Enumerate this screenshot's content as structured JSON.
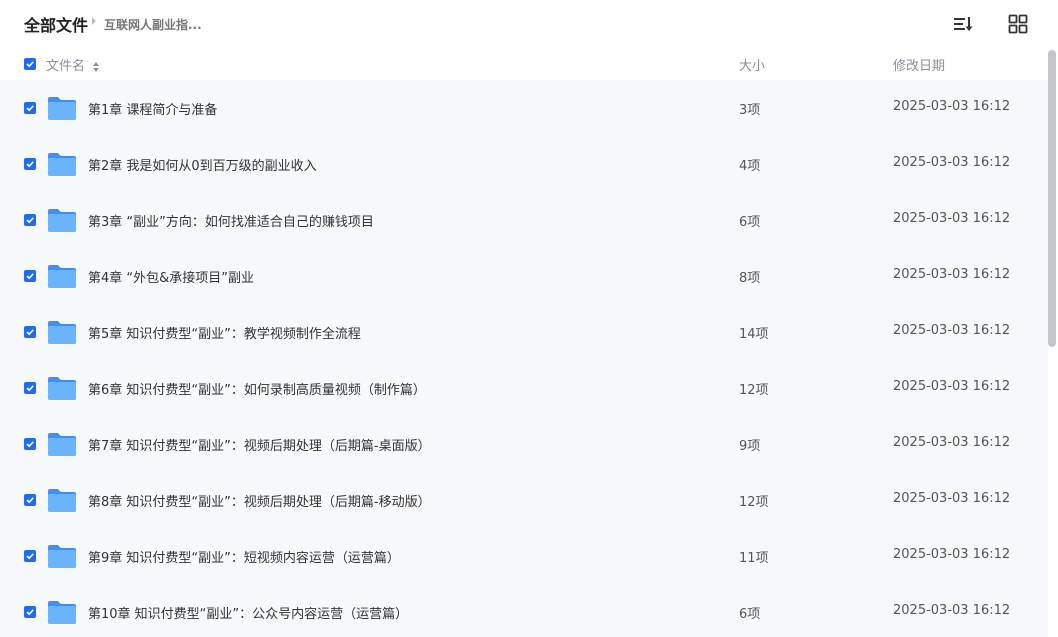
{
  "breadcrumb": {
    "root": "全部文件",
    "current": "互联网人副业指..."
  },
  "toolbar": {
    "sort_icon": "sort-list-icon",
    "view_icon": "grid-view-icon"
  },
  "columns": {
    "name": "文件名",
    "size": "大小",
    "date": "修改日期"
  },
  "colors": {
    "accent": "#1e6bf0",
    "folder": "#5aa9f7",
    "row_bg": "#f7f8fc"
  },
  "rows": [
    {
      "name": "第1章 课程简介与准备",
      "size": "3项",
      "date": "2025-03-03 16:12"
    },
    {
      "name": "第2章 我是如何从0到百万级的副业收入",
      "size": "4项",
      "date": "2025-03-03 16:12"
    },
    {
      "name": "第3章 “副业”方向：如何找准适合自己的赚钱项目",
      "size": "6项",
      "date": "2025-03-03 16:12"
    },
    {
      "name": "第4章 “外包&承接项目”副业",
      "size": "8项",
      "date": "2025-03-03 16:12"
    },
    {
      "name": "第5章 知识付费型“副业”：教学视频制作全流程",
      "size": "14项",
      "date": "2025-03-03 16:12"
    },
    {
      "name": "第6章 知识付费型“副业”：如何录制高质量视频（制作篇）",
      "size": "12项",
      "date": "2025-03-03 16:12"
    },
    {
      "name": "第7章 知识付费型“副业”：视频后期处理（后期篇-桌面版）",
      "size": "9项",
      "date": "2025-03-03 16:12"
    },
    {
      "name": "第8章 知识付费型“副业”：视频后期处理（后期篇-移动版）",
      "size": "12项",
      "date": "2025-03-03 16:12"
    },
    {
      "name": "第9章 知识付费型“副业”：短视频内容运营（运营篇）",
      "size": "11项",
      "date": "2025-03-03 16:12"
    },
    {
      "name": "第10章 知识付费型“副业”：公众号内容运营（运营篇）",
      "size": "6项",
      "date": "2025-03-03 16:12"
    }
  ]
}
